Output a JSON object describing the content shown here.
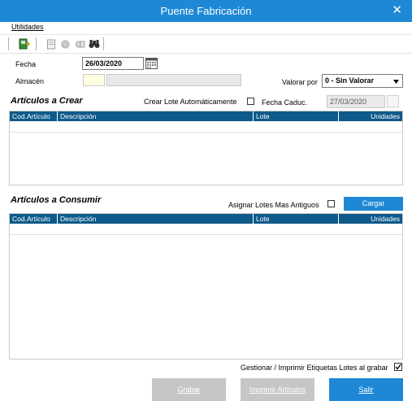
{
  "window": {
    "title": "Puente Fabricación",
    "close_glyph": "✕"
  },
  "menu": {
    "utilidades": "Utilidades"
  },
  "toolbar": {
    "icons": [
      "exit-icon",
      "document-icon",
      "gear-icon",
      "settings-icon",
      "binoculars-icon"
    ]
  },
  "form": {
    "fecha_label": "Fecha",
    "fecha_value": "26/03/2020",
    "almacen_label": "Almacén",
    "almacen_code": "",
    "almacen_name": "",
    "valorar_label": "Valorar por",
    "valorar_value": "0 - Sin Valorar"
  },
  "crear": {
    "title": "Artículos a Crear",
    "lote_auto_label": "Crear Lote Automáticamente",
    "fecha_caduc_label": "Fecha Caduc.",
    "fecha_caduc_value": "27/03/2020",
    "columns": [
      "Cod.Artículo",
      "Descripción",
      "Lote",
      "Unidades"
    ]
  },
  "consumir": {
    "title": "Artículos a Consumir",
    "asignar_label": "Asignar Lotes Mas Antiguos",
    "cargar_label": "Cargar",
    "columns": [
      "Cod.Artículo",
      "Descripción",
      "Lote",
      "Unidades"
    ]
  },
  "footer": {
    "etiquetas_label": "Gestionar / Imprimir Etiquetas Lotes al grabar",
    "etiquetas_checked": true,
    "grabar_label": "Grabar",
    "imprimir_label": "Imprimir Artículos",
    "salir_label": "Salir"
  },
  "colors": {
    "accent": "#1e88d6",
    "grid_header": "#0e5a8a",
    "disabled_button": "#c6c6c6"
  }
}
